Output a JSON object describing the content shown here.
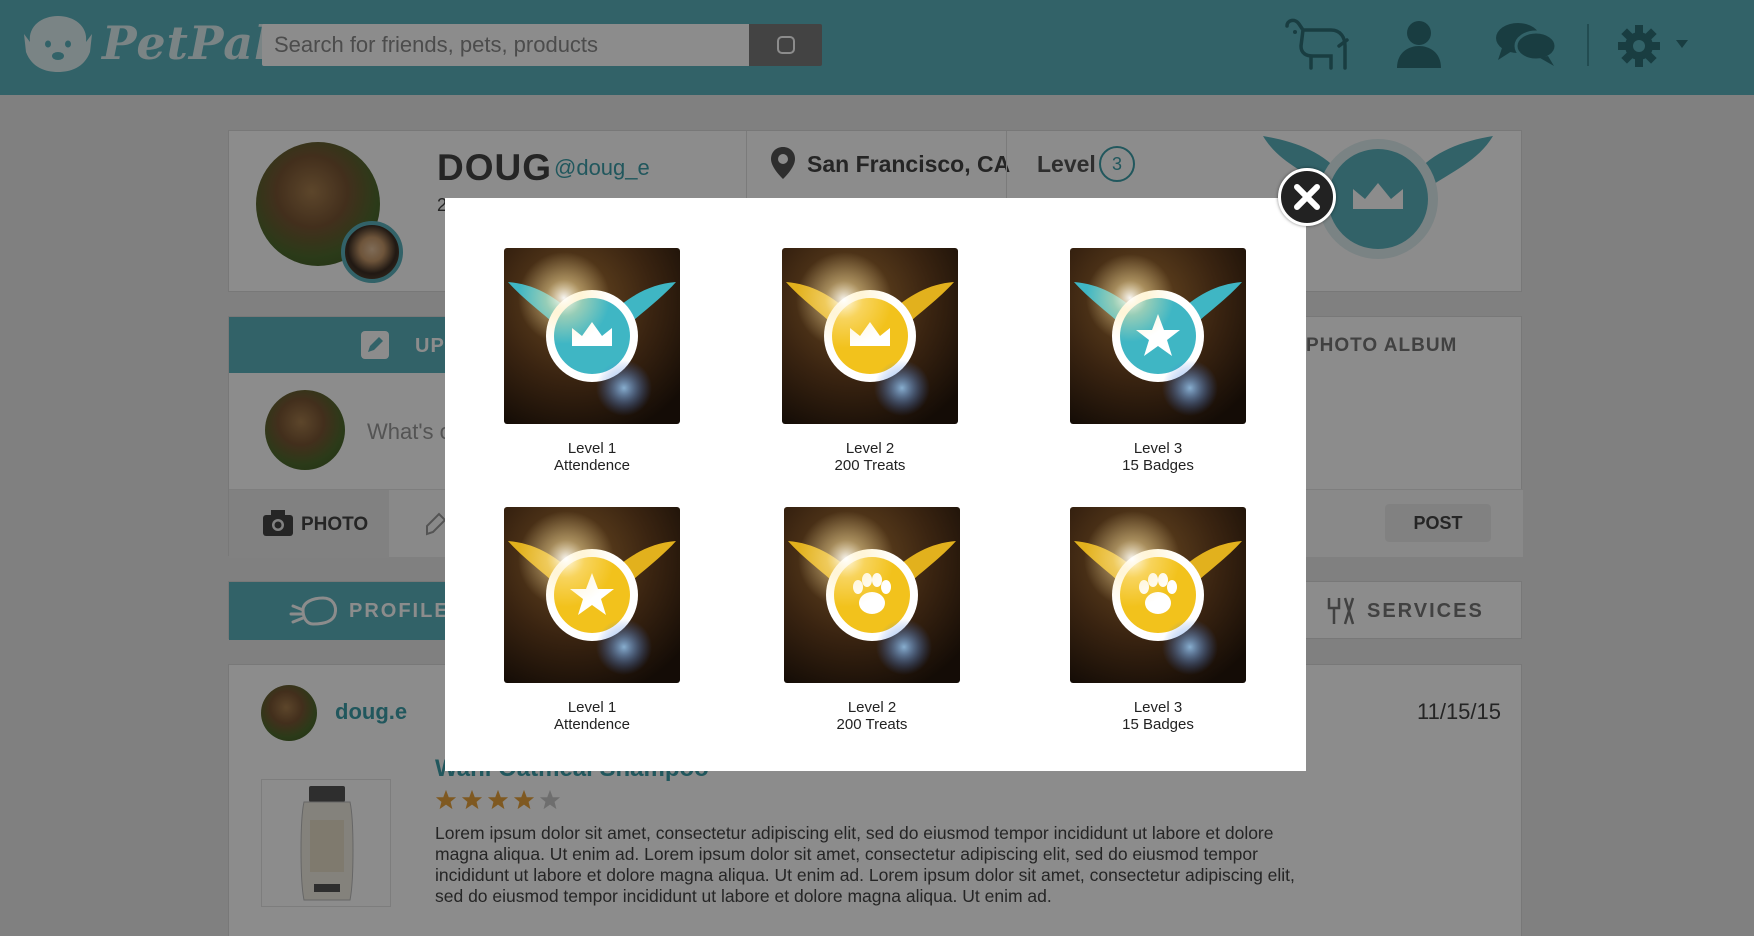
{
  "header": {
    "brand": "PetPal",
    "search_placeholder": "Search for friends, pets, products",
    "icons": [
      "pet-icon",
      "user-icon",
      "chat-icon",
      "gear-icon",
      "caret-down-icon"
    ]
  },
  "profile": {
    "name": "DOUG",
    "handle": "@doug_e",
    "truncated_stat": "2",
    "location": "San Francisco, CA",
    "level_label": "Level",
    "level": "3"
  },
  "update": {
    "tab_label": "UPD",
    "photo_album_label": "PHOTO ALBUM",
    "prompt": "What's o",
    "photo_label": "PHOTO",
    "post_label": "POST"
  },
  "nav": {
    "profile_label": "PROFILE",
    "services_label": "SERVICES"
  },
  "feed": {
    "user": "doug.e",
    "date": "11/15/15",
    "title": "Wahl Oatmeal Shampoo",
    "rating": 4,
    "rating_max": 5,
    "text": "Lorem ipsum dolor sit amet, consectetur adipiscing elit, sed do eiusmod tempor incididunt ut labore et dolore magna aliqua. Ut enim ad. Lorem ipsum dolor sit amet, consectetur adipiscing elit, sed do eiusmod tempor incididunt ut labore et dolore magna aliqua. Ut enim ad. Lorem ipsum dolor sit amet, consectetur adipiscing elit, sed do eiusmod tempor incididunt ut labore et dolore magna aliqua. Ut enim ad."
  },
  "colors": {
    "brand": "#5bb3be",
    "teal_badge": "#3fb6c4",
    "gold_badge": "#f2c21c"
  },
  "modal": {
    "badges": [
      {
        "level": "Level 1",
        "name": "Attendence",
        "color": "teal",
        "symbol": "crown"
      },
      {
        "level": "Level 2",
        "name": "200 Treats",
        "color": "gold",
        "symbol": "crown"
      },
      {
        "level": "Level 3",
        "name": "15 Badges",
        "color": "teal",
        "symbol": "star"
      },
      {
        "level": "Level 1",
        "name": "Attendence",
        "color": "gold",
        "symbol": "star"
      },
      {
        "level": "Level 2",
        "name": "200 Treats",
        "color": "gold",
        "symbol": "paw"
      },
      {
        "level": "Level 3",
        "name": "15 Badges",
        "color": "gold",
        "symbol": "paw"
      }
    ]
  }
}
